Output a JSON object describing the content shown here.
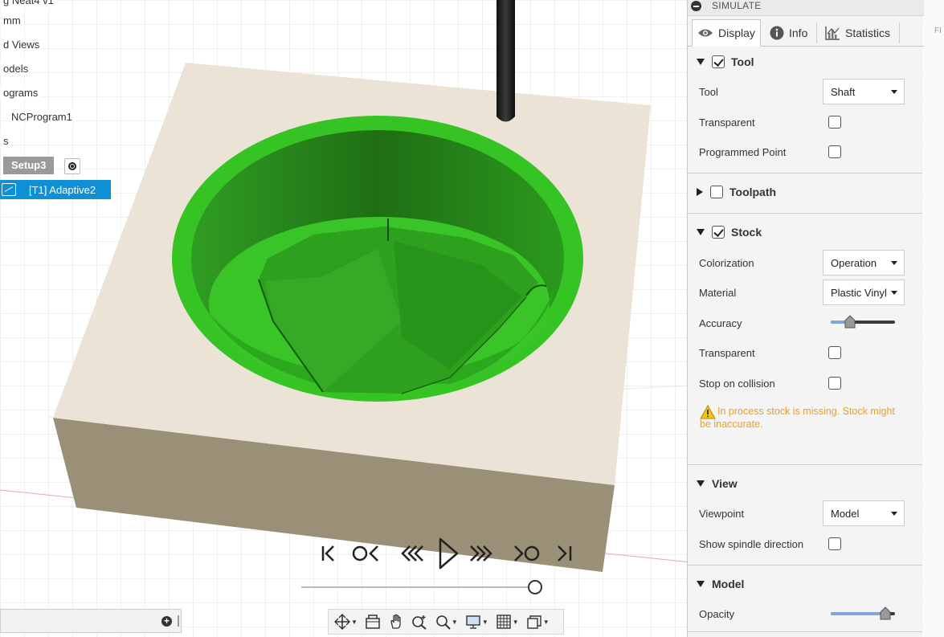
{
  "browser_tree": {
    "items": [
      {
        "label": "g Neat4 v1"
      },
      {
        "label": "mm"
      },
      {
        "label": "d Views"
      },
      {
        "label": "odels"
      },
      {
        "label": "ograms"
      },
      {
        "label": "NCProgram1"
      },
      {
        "label": "s"
      }
    ],
    "setup_label": "Setup3",
    "operation_label": "[T1] Adaptive2"
  },
  "playback": {
    "buttons": [
      "go-to-start",
      "previous-operation",
      "step-back",
      "play",
      "step-forward",
      "next-operation",
      "go-to-end"
    ]
  },
  "simulate_panel": {
    "title": "SIMULATE",
    "tabs": [
      {
        "label": "Display",
        "icon": "eye-icon",
        "active": true
      },
      {
        "label": "Info",
        "icon": "info-icon"
      },
      {
        "label": "Statistics",
        "icon": "chart-icon"
      }
    ],
    "tool": {
      "header": "Tool",
      "enabled": true,
      "tool_label": "Tool",
      "tool_value": "Shaft",
      "transparent_label": "Transparent",
      "programmed_point_label": "Programmed Point"
    },
    "toolpath": {
      "header": "Toolpath",
      "enabled": false
    },
    "stock": {
      "header": "Stock",
      "enabled": true,
      "colorization_label": "Colorization",
      "colorization_value": "Operation",
      "material_label": "Material",
      "material_value": "Plastic Vinyl",
      "accuracy_label": "Accuracy",
      "accuracy_level": 0.3,
      "transparent_label": "Transparent",
      "stop_on_collision_label": "Stop on collision",
      "warning": "In process stock is missing. Stock might be inaccurate."
    },
    "view": {
      "header": "View",
      "viewpoint_label": "Viewpoint",
      "viewpoint_value": "Model",
      "spindle_label": "Show spindle direction"
    },
    "model": {
      "header": "Model",
      "opacity_label": "Opacity",
      "opacity_level": 0.85
    }
  },
  "edge_text": "FI",
  "colors": {
    "accent": "#0e8fd6",
    "stock_face": "#ebe3d6",
    "stock_side": "#9a9078",
    "cut_green": "#33c122",
    "warning": "#e8a02a"
  }
}
